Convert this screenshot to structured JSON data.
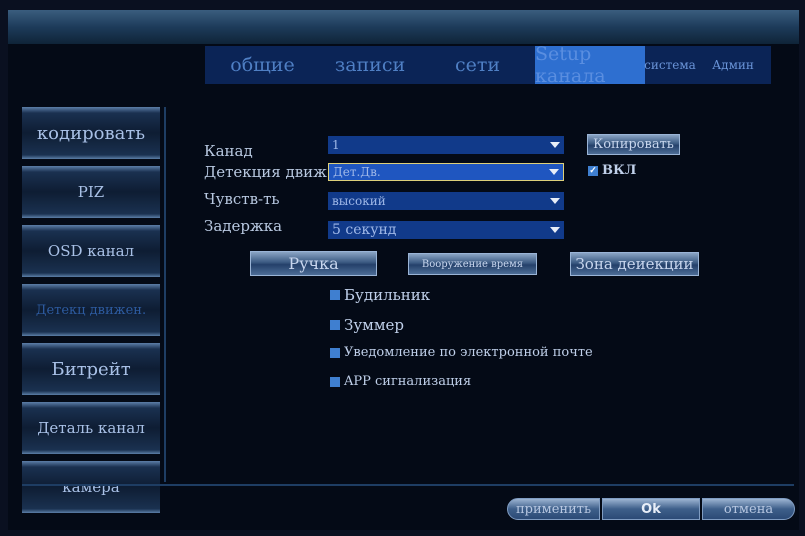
{
  "tabs": [
    "общие",
    "записи",
    "сети",
    "Setup канала",
    "система",
    "Админ"
  ],
  "sidebar": {
    "items": [
      "кодировать",
      "PIZ",
      "OSD канал",
      "Детекц движен.",
      "Битрейт",
      "Деталь канал",
      "камера"
    ]
  },
  "form": {
    "channel_label": "Канад",
    "channel_value": "1",
    "detect_label": "Детекция движ.",
    "detect_value": "Дет.Дв.",
    "sens_label": "Чувств-ть",
    "sens_value": "высокий",
    "delay_label": "Задержка",
    "delay_value": "5 секунд",
    "copy_button": "Копировать",
    "enable_label": "ВКЛ"
  },
  "actions": {
    "handle": "Ручка",
    "arm_time": "Вооружение время",
    "zone": "Зона деиекции"
  },
  "checks": [
    "Будильник",
    "Зуммер",
    "Уведомление по электронной почте",
    "APP сигнализация"
  ],
  "bottom": {
    "apply": "применить",
    "ok": "Ok",
    "cancel": "отмена"
  },
  "colors": {
    "accent": "#2e6fd0",
    "tabbar": "#0b2456",
    "dropdown": "#113a8a"
  }
}
